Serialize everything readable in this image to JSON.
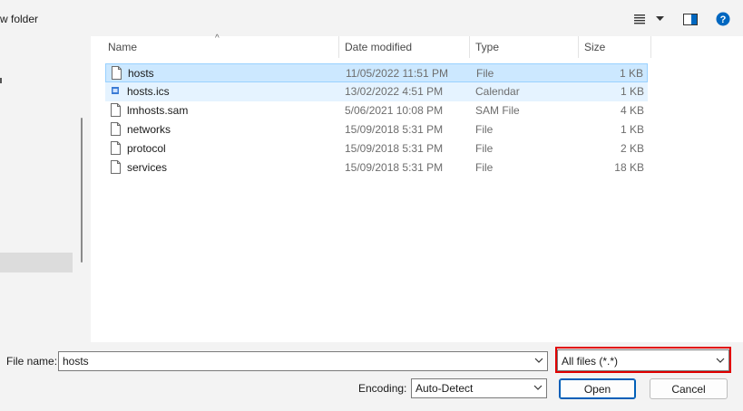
{
  "toolbar": {
    "new_folder_label": "w folder"
  },
  "columns": {
    "name": "Name",
    "date": "Date modified",
    "type": "Type",
    "size": "Size"
  },
  "files": [
    {
      "name": "hosts",
      "date": "11/05/2022 11:51 PM",
      "type": "File",
      "size": "1 KB",
      "icon": "file-icon",
      "state": "selected"
    },
    {
      "name": "hosts.ics",
      "date": "13/02/2022 4:51 PM",
      "type": "Calendar",
      "size": "1 KB",
      "icon": "calendar-file-icon",
      "state": "hover"
    },
    {
      "name": "lmhosts.sam",
      "date": "5/06/2021 10:08 PM",
      "type": "SAM File",
      "size": "4 KB",
      "icon": "file-icon",
      "state": ""
    },
    {
      "name": "networks",
      "date": "15/09/2018 5:31 PM",
      "type": "File",
      "size": "1 KB",
      "icon": "file-icon",
      "state": ""
    },
    {
      "name": "protocol",
      "date": "15/09/2018 5:31 PM",
      "type": "File",
      "size": "2 KB",
      "icon": "file-icon",
      "state": ""
    },
    {
      "name": "services",
      "date": "15/09/2018 5:31 PM",
      "type": "File",
      "size": "18 KB",
      "icon": "file-icon",
      "state": ""
    }
  ],
  "bottom": {
    "file_name_label": "File name:",
    "file_name_value": "hosts",
    "filter_value": "All files  (*.*)",
    "encoding_label": "Encoding:",
    "encoding_value": "Auto-Detect",
    "open_label": "Open",
    "cancel_label": "Cancel"
  },
  "colors": {
    "selection": "#cce8ff",
    "hover": "#e5f3ff",
    "highlight_box": "#e00000",
    "primary_button": "#005fb8",
    "help_icon": "#0067c0"
  }
}
